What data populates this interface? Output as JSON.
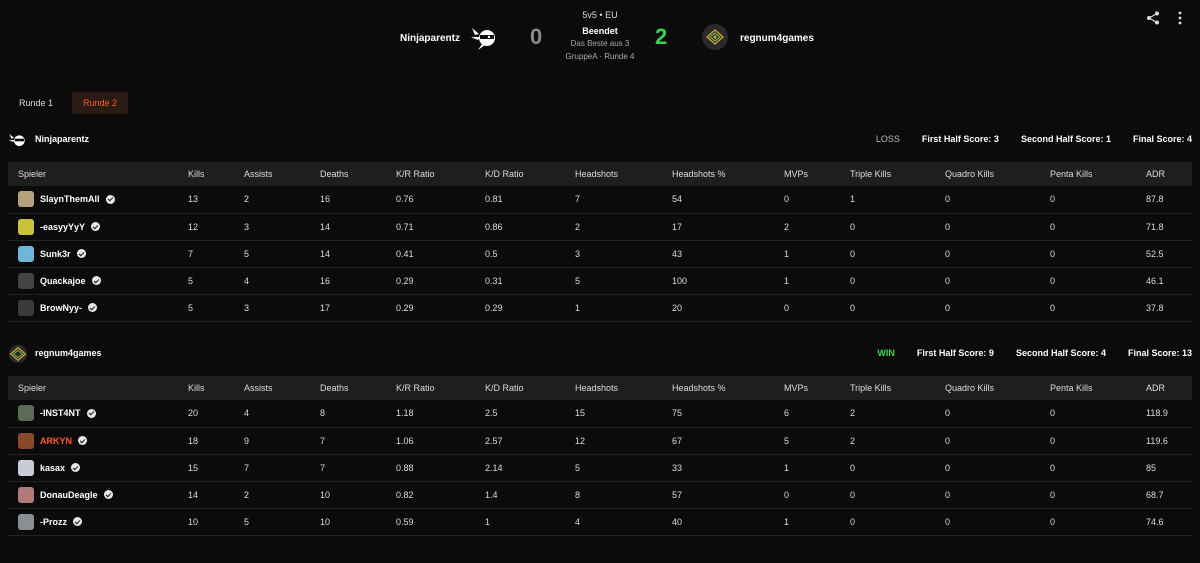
{
  "header": {
    "team_left": "Ninjaparentz",
    "team_right": "regnum4games",
    "score_left": "0",
    "score_right": "2",
    "mode": "5v5 • EU",
    "status": "Beendet",
    "format": "Das Beste aus 3",
    "stage": "GruppeA · Runde 4"
  },
  "tabs": [
    {
      "label": "Runde 1",
      "active": false
    },
    {
      "label": "Runde 2",
      "active": true
    }
  ],
  "columns": [
    "Spieler",
    "Kills",
    "Assists",
    "Deaths",
    "K/R Ratio",
    "K/D Ratio",
    "Headshots",
    "Headshots %",
    "MVPs",
    "Triple Kills",
    "Quadro Kills",
    "Penta Kills",
    "ADR"
  ],
  "teams": [
    {
      "name": "Ninjaparentz",
      "result": "LOSS",
      "first_half": "First Half Score: 3",
      "second_half": "Second Half Score: 1",
      "final": "Final Score: 4",
      "players": [
        {
          "name": "SlaynThemAll",
          "stats": [
            "13",
            "2",
            "16",
            "0.76",
            "0.81",
            "7",
            "54",
            "0",
            "1",
            "0",
            "0",
            "87.8"
          ],
          "avatar_color": "#b5a27a"
        },
        {
          "name": "-easyyYyY",
          "stats": [
            "12",
            "3",
            "14",
            "0.71",
            "0.86",
            "2",
            "17",
            "2",
            "0",
            "0",
            "0",
            "71.8"
          ],
          "avatar_color": "#c9c23a"
        },
        {
          "name": "Sunk3r",
          "stats": [
            "7",
            "5",
            "14",
            "0.41",
            "0.5",
            "3",
            "43",
            "1",
            "0",
            "0",
            "0",
            "52.5"
          ],
          "avatar_color": "#6fb6d8"
        },
        {
          "name": "Quackajoe",
          "stats": [
            "5",
            "4",
            "16",
            "0.29",
            "0.31",
            "5",
            "100",
            "1",
            "0",
            "0",
            "0",
            "46.1"
          ],
          "avatar_color": "#444444"
        },
        {
          "name": "BrowNyy-",
          "stats": [
            "5",
            "3",
            "17",
            "0.29",
            "0.29",
            "1",
            "20",
            "0",
            "0",
            "0",
            "0",
            "37.8"
          ],
          "avatar_color": "#3a3a3a"
        }
      ]
    },
    {
      "name": "regnum4games",
      "result": "WIN",
      "first_half": "First Half Score: 9",
      "second_half": "Second Half Score: 4",
      "final": "Final Score: 13",
      "players": [
        {
          "name": "-INST4NT",
          "stats": [
            "20",
            "4",
            "8",
            "1.18",
            "2.5",
            "15",
            "75",
            "6",
            "2",
            "0",
            "0",
            "118.9"
          ],
          "avatar_color": "#5b6b55"
        },
        {
          "name": "ARKYN",
          "stats": [
            "18",
            "9",
            "7",
            "1.06",
            "2.57",
            "12",
            "67",
            "5",
            "2",
            "0",
            "0",
            "119.6"
          ],
          "avatar_color": "#8a4a2a",
          "highlight": true
        },
        {
          "name": "kasax",
          "stats": [
            "15",
            "7",
            "7",
            "0.88",
            "2.14",
            "5",
            "33",
            "1",
            "0",
            "0",
            "0",
            "85"
          ],
          "avatar_color": "#c8ccd4"
        },
        {
          "name": "DonauDeagle",
          "stats": [
            "14",
            "2",
            "10",
            "0.82",
            "1.4",
            "8",
            "57",
            "0",
            "0",
            "0",
            "0",
            "68.7"
          ],
          "avatar_color": "#b07a7a"
        },
        {
          "name": "-Prozz",
          "stats": [
            "10",
            "5",
            "10",
            "0.59",
            "1",
            "4",
            "40",
            "1",
            "0",
            "0",
            "0",
            "74.6"
          ],
          "avatar_color": "#8a8f96"
        }
      ]
    }
  ],
  "icons": {
    "share": "share-icon",
    "more": "more-vertical-icon",
    "verified": "verified-check-icon"
  },
  "colors": {
    "accent": "#ff5a1f",
    "win": "#32d74b",
    "background": "#0b0b0b"
  }
}
